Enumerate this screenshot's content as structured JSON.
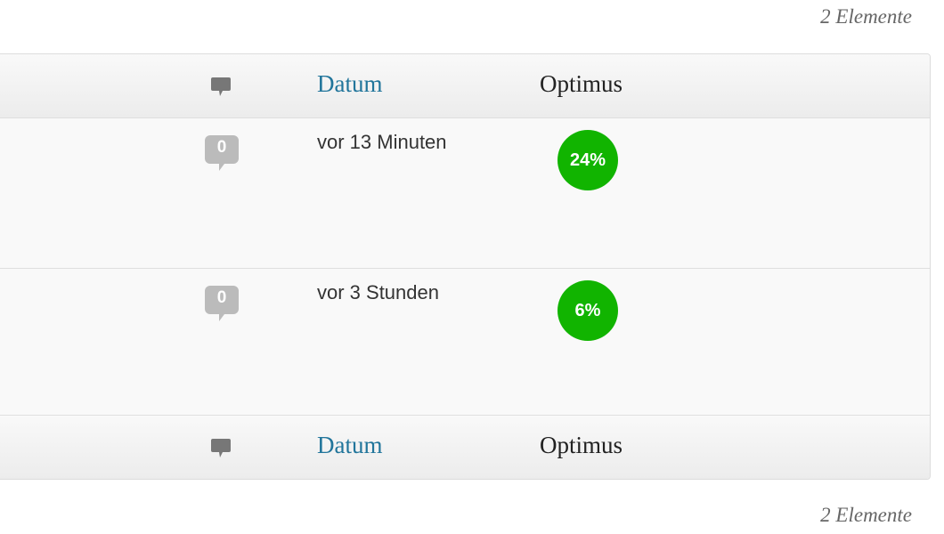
{
  "count_top": "2 Elemente",
  "count_bottom": "2 Elemente",
  "header": {
    "date_label": "Datum",
    "optimus_label": "Optimus"
  },
  "footer": {
    "date_label": "Datum",
    "optimus_label": "Optimus"
  },
  "rows": [
    {
      "comments": "0",
      "date": "vor 13 Minuten",
      "optimus": "24%"
    },
    {
      "comments": "0",
      "date": "vor 3 Stunden",
      "optimus": "6%"
    }
  ],
  "colors": {
    "link": "#21759b",
    "badge_green": "#11b400",
    "bubble_gray": "#bbbbbb",
    "header_icon_gray": "#777777"
  },
  "icons": {
    "header_comment": "comment-bubble-icon"
  }
}
